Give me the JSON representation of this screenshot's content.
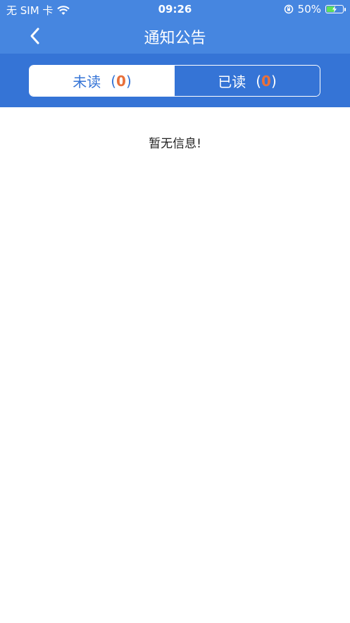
{
  "status_bar": {
    "carrier": "无 SIM 卡",
    "time": "09:26",
    "battery_percent": "50%",
    "battery_level": 0.5,
    "icons": [
      "wifi-icon",
      "orientation-lock-icon",
      "battery-charging-icon"
    ]
  },
  "nav": {
    "title": "通知公告",
    "back_icon": "chevron-left-icon"
  },
  "tabs": [
    {
      "label": "未读",
      "open": "(",
      "count": "0",
      "close": ")",
      "active": true
    },
    {
      "label": "已读",
      "open": "(",
      "count": "0",
      "close": ")",
      "active": false
    }
  ],
  "content": {
    "empty_message": "暂无信息!"
  },
  "colors": {
    "nav_blue": "#4686e0",
    "tab_blue": "#3574d6",
    "count_orange": "#e8703b"
  }
}
